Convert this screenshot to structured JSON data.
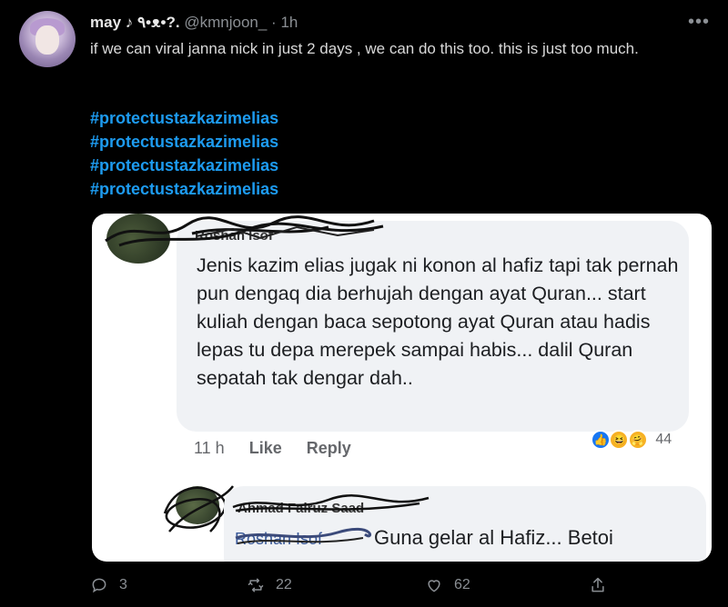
{
  "tweet": {
    "display_name": "may ♪ ٩•ᴥ•?.",
    "handle": "@kmnjoon_",
    "separator": "·",
    "time": "1h",
    "more_icon": "more-horizontal-icon",
    "text": "if we can viral janna nick in just 2 days , we can do this too. this is just too much.",
    "hashtags": [
      "#protectustazkazimelias",
      "#protectustazkazimelias",
      "#protectustazkazimelias",
      "#protectustazkazimelias"
    ],
    "hashtag_color": "#1d9bf0"
  },
  "screenshot": {
    "comment1": {
      "author_scribbled": "Roshan Isof",
      "text": "Jenis kazim elias jugak ni konon al hafiz tapi tak pernah pun dengaq dia berhujah dengan ayat Quran... start kuliah dengan baca sepotong ayat Quran atau hadis lepas tu depa merepek sampai habis... dalil Quran sepatah tak dengar dah..",
      "time": "11 h",
      "like_label": "Like",
      "reply_label": "Reply",
      "reaction_icons": [
        "like-reaction-icon",
        "haha-reaction-icon",
        "care-reaction-icon"
      ],
      "reaction_count": "44"
    },
    "comment2": {
      "author_scribbled": "Ahmad Fairuz Saad",
      "mention_scribbled": "Roshan Isof",
      "text": "Guna gelar al Hafiz... Betoi"
    }
  },
  "footer": {
    "reply_count": "3",
    "retweet_count": "22",
    "like_count": "62",
    "icons": [
      "reply-icon",
      "retweet-icon",
      "like-icon",
      "share-icon"
    ]
  }
}
